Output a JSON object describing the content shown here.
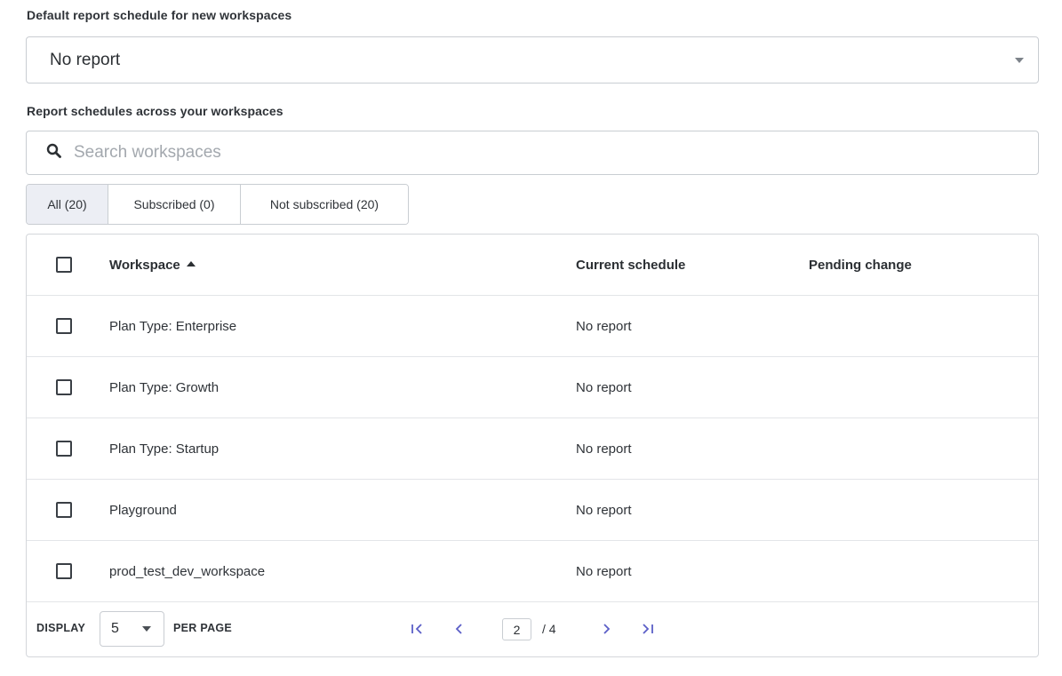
{
  "default_schedule": {
    "label": "Default report schedule for new workspaces",
    "value": "No report"
  },
  "schedules": {
    "label": "Report schedules across your workspaces",
    "search_placeholder": "Search workspaces",
    "tabs": [
      {
        "label": "All (20)",
        "active": true
      },
      {
        "label": "Subscribed (0)",
        "active": false
      },
      {
        "label": "Not subscribed (20)",
        "active": false
      }
    ]
  },
  "table": {
    "columns": {
      "workspace": "Workspace",
      "current": "Current schedule",
      "pending": "Pending change"
    },
    "rows": [
      {
        "workspace": "Plan Type: Enterprise",
        "current": "No report",
        "pending": ""
      },
      {
        "workspace": "Plan Type: Growth",
        "current": "No report",
        "pending": ""
      },
      {
        "workspace": "Plan Type: Startup",
        "current": "No report",
        "pending": ""
      },
      {
        "workspace": "Playground",
        "current": "No report",
        "pending": ""
      },
      {
        "workspace": "prod_test_dev_workspace",
        "current": "No report",
        "pending": ""
      }
    ]
  },
  "pagination": {
    "display_label": "DISPLAY",
    "per_page_value": "5",
    "per_page_label": "PER PAGE",
    "current_page": "2",
    "total_text": "/ 4"
  },
  "colors": {
    "pager_accent": "#5b5fc7",
    "active_tab_bg": "#eceef4"
  }
}
